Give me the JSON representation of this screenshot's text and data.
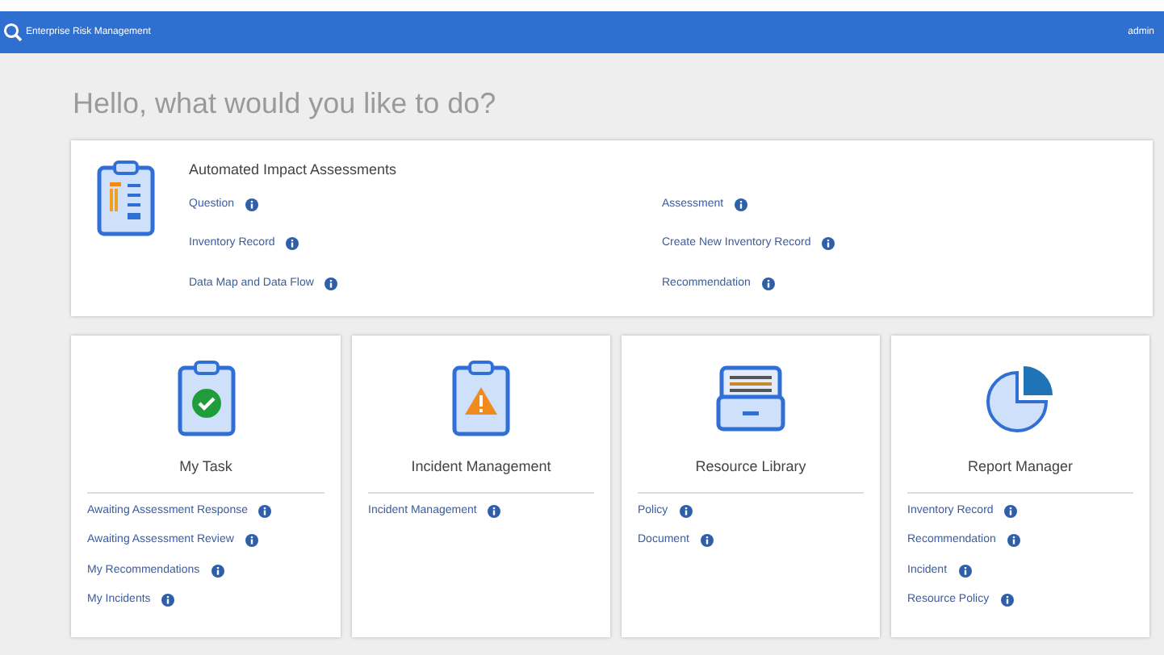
{
  "header": {
    "title": "Enterprise Risk Management",
    "user": "admin"
  },
  "greeting": "Hello, what would you like to do?",
  "feature": {
    "title": "Automated Impact Assessments",
    "links": [
      "Question",
      "Assessment",
      "Inventory Record",
      "Create New Inventory Record",
      "Data Map and Data Flow",
      "Recommendation"
    ]
  },
  "cards": [
    {
      "kind": "task",
      "title": "My Task",
      "links": [
        "Awaiting Assessment Response",
        "Awaiting Assessment Review",
        "My Recommendations",
        "My Incidents"
      ]
    },
    {
      "kind": "incident",
      "title": "Incident Management",
      "links": [
        "Incident Management"
      ]
    },
    {
      "kind": "library",
      "title": "Resource Library",
      "links": [
        "Policy",
        "Document"
      ]
    },
    {
      "kind": "report",
      "title": "Report Manager",
      "links": [
        "Inventory Record",
        "Recommendation",
        "Incident",
        "Resource Policy"
      ]
    }
  ]
}
